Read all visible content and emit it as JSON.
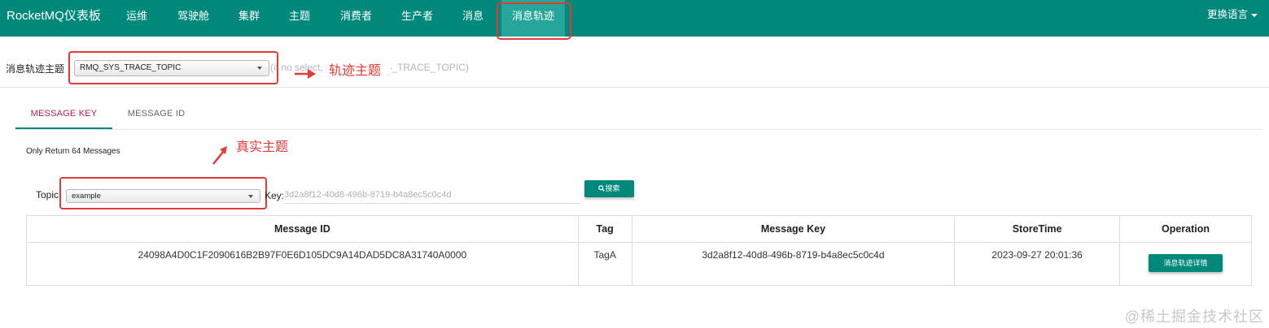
{
  "navbar": {
    "brand": "RocketMQ仪表板",
    "items": [
      {
        "label": "运维"
      },
      {
        "label": "驾驶舱"
      },
      {
        "label": "集群"
      },
      {
        "label": "主题"
      },
      {
        "label": "消费者"
      },
      {
        "label": "生产者"
      },
      {
        "label": "消息"
      },
      {
        "label": "消息轨迹"
      }
    ],
    "active_item": "消息轨迹",
    "language_label": "更换语言"
  },
  "trace_topic": {
    "label": "消息轨迹主题",
    "selected": "RMQ_SYS_TRACE_TOPIC",
    "hint": "(if no select, use RMQ_SYS_TRACE_TOPIC)"
  },
  "tabs": [
    {
      "label": "MESSAGE KEY",
      "active": true
    },
    {
      "label": "MESSAGE ID",
      "active": false
    }
  ],
  "info": "Only Return 64 Messages",
  "search": {
    "topic_label": "Topic:",
    "topic_selected": "example",
    "key_label": "Key:",
    "key_value": "3d2a8f12-40d8-496b-8719-b4a8ec5c0c4d",
    "button_label": "搜索",
    "button_icon": "search-icon"
  },
  "table": {
    "headers": [
      "Message ID",
      "Tag",
      "Message Key",
      "StoreTime",
      "Operation"
    ],
    "rows": [
      {
        "message_id": "24098A4D0C1F2090616B2B97F0E6D105DC9A14DAD5DC8A31740A0000",
        "tag": "TagA",
        "message_key": "3d2a8f12-40d8-496b-8719-b4a8ec5c0c4d",
        "store_time": "2023-09-27 20:01:36",
        "operation_label": "消息轨迹详情"
      }
    ]
  },
  "annotations": {
    "trace_topic_note": "轨迹主题",
    "real_topic_note": "真实主题",
    "color": "#e53935"
  },
  "colors": {
    "primary": "#00897b",
    "active_tab_text": "#c2185b"
  },
  "watermark": "@稀土掘金技术社区"
}
